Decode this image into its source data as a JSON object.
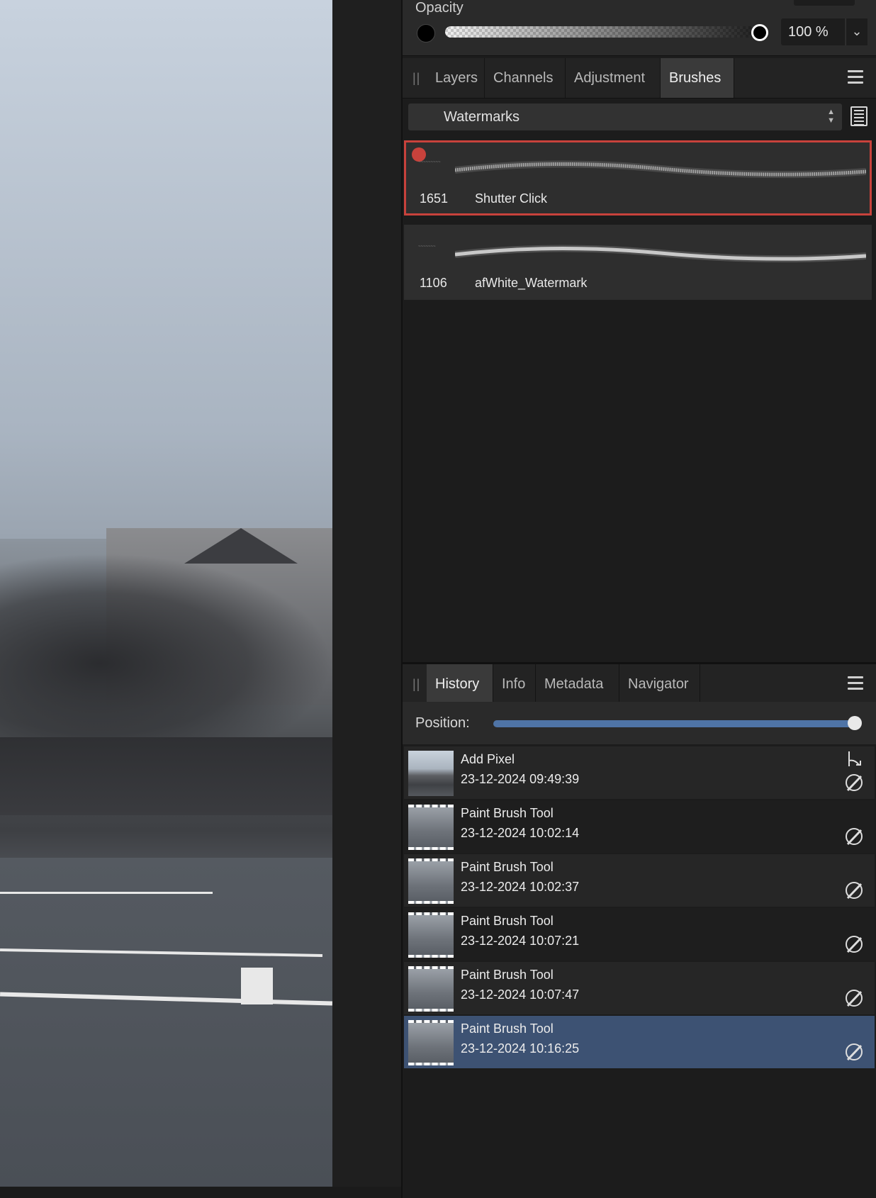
{
  "opacity": {
    "label": "Opacity",
    "value_text": "100 %",
    "fill_fraction": 1.0
  },
  "studio_tabs": [
    {
      "label": "Layers",
      "active": false
    },
    {
      "label": "Channels",
      "active": false
    },
    {
      "label": "Adjustment",
      "active": false
    },
    {
      "label": "Brushes",
      "active": true
    }
  ],
  "brushes": {
    "category": "Watermarks",
    "items": [
      {
        "size": "1651",
        "name": "Shutter Click",
        "selected": true
      },
      {
        "size": "1106",
        "name": "afWhite_Watermark",
        "selected": false
      }
    ]
  },
  "history_tabs": [
    {
      "label": "History",
      "active": true
    },
    {
      "label": "Info",
      "active": false
    },
    {
      "label": "Metadata",
      "active": false
    },
    {
      "label": "Navigator",
      "active": false
    }
  ],
  "history": {
    "position_label": "Position:",
    "position_fraction": 1.0,
    "entries": [
      {
        "title": "Add Pixel",
        "time": "23-12-2024 09:49:39",
        "selected": false
      },
      {
        "title": "Paint Brush Tool",
        "time": "23-12-2024 10:02:14",
        "selected": false
      },
      {
        "title": "Paint Brush Tool",
        "time": "23-12-2024 10:02:37",
        "selected": false
      },
      {
        "title": "Paint Brush Tool",
        "time": "23-12-2024 10:07:21",
        "selected": false
      },
      {
        "title": "Paint Brush Tool",
        "time": "23-12-2024 10:07:47",
        "selected": false
      },
      {
        "title": "Paint Brush Tool",
        "time": "23-12-2024 10:16:25",
        "selected": true
      }
    ]
  },
  "colors": {
    "selection_outline": "#c8423c",
    "history_selected": "#3d5273",
    "position_track": "#4f74a6"
  },
  "icons": {
    "panel_menu": "hamburger-menu-icon",
    "list_view": "list-view-icon",
    "history_brush": "paint-brush-icon",
    "history_branch": "branch-icon"
  }
}
